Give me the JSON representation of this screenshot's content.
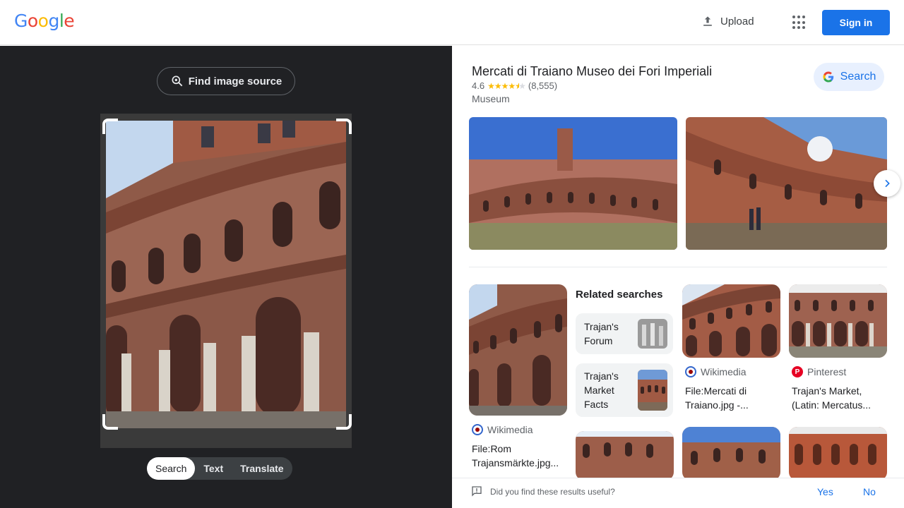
{
  "header": {
    "logo_letters": [
      "G",
      "o",
      "o",
      "g",
      "l",
      "e"
    ],
    "logo_colors": [
      "#4285f4",
      "#ea4335",
      "#fbbc05",
      "#4285f4",
      "#34a853",
      "#ea4335"
    ],
    "upload_label": "Upload",
    "signin_label": "Sign in"
  },
  "left_panel": {
    "find_source_label": "Find image source",
    "modes": [
      "Search",
      "Text",
      "Translate"
    ],
    "active_mode": "Search"
  },
  "knowledge": {
    "title": "Mercati di Traiano Museo dei Fori Imperiali",
    "rating": "4.6",
    "rating_value": 4.6,
    "reviews": "(8,555)",
    "category": "Museum",
    "search_label": "Search"
  },
  "results": [
    {
      "source": "Wikimedia",
      "title_line1": "File:Rom",
      "title_line2": "Trajansmärkte.jpg..."
    },
    {
      "source": "Wikimedia",
      "title_line1": "File:Mercati di",
      "title_line2": "Traiano.jpg -..."
    },
    {
      "source": "Pinterest",
      "title_line1": "Trajan's Market,",
      "title_line2": "(Latin: Mercatus..."
    }
  ],
  "related": {
    "heading": "Related searches",
    "items": [
      {
        "line1": "Trajan's",
        "line2": "Forum",
        "line3": ""
      },
      {
        "line1": "Trajan's",
        "line2": "Market",
        "line3": "Facts"
      }
    ]
  },
  "feedback": {
    "question": "Did you find these results useful?",
    "yes": "Yes",
    "no": "No"
  },
  "colors": {
    "accent": "#1a73e8",
    "dark_panel": "#202124"
  }
}
